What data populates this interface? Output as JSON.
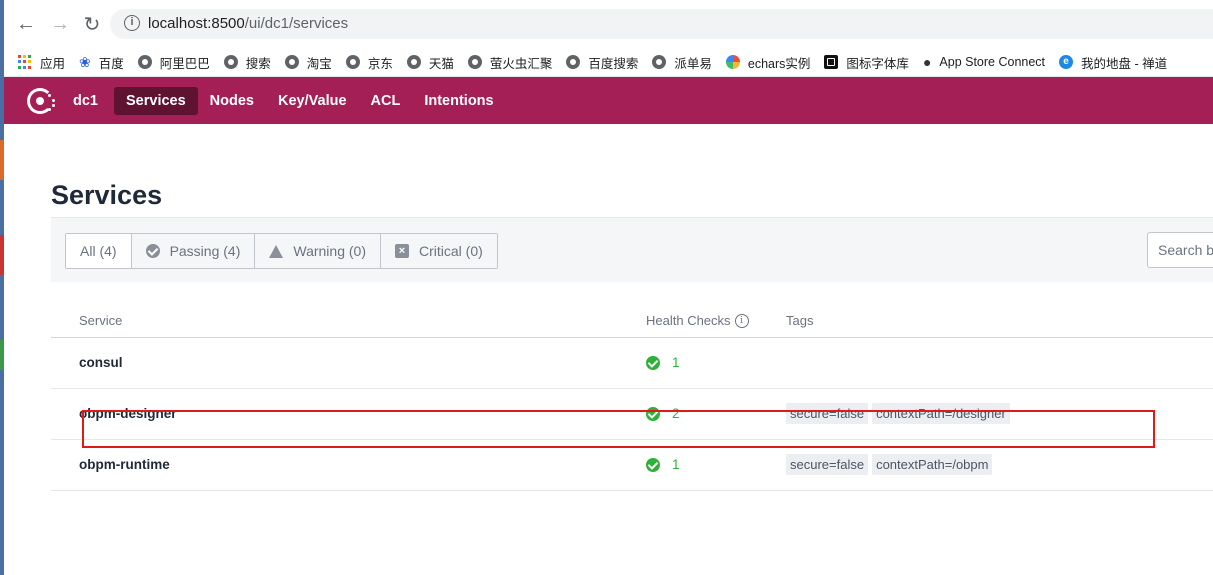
{
  "browser": {
    "url_host": "localhost:8500",
    "url_path": "/ui/dc1/services"
  },
  "bookmarks": [
    {
      "label": "应用",
      "icon": "apps-grid-icon"
    },
    {
      "label": "百度",
      "icon": "baidu-paw-icon"
    },
    {
      "label": "阿里巴巴",
      "icon": "globe-icon"
    },
    {
      "label": "搜索",
      "icon": "globe-icon"
    },
    {
      "label": "淘宝",
      "icon": "globe-icon"
    },
    {
      "label": "京东",
      "icon": "globe-icon"
    },
    {
      "label": "天猫",
      "icon": "globe-icon"
    },
    {
      "label": "萤火虫汇聚",
      "icon": "globe-icon"
    },
    {
      "label": "百度搜索",
      "icon": "globe-icon"
    },
    {
      "label": "派单易",
      "icon": "globe-icon"
    },
    {
      "label": "echars实例",
      "icon": "echarts-icon"
    },
    {
      "label": "图标字体库",
      "icon": "iconfont-icon"
    },
    {
      "label": "App Store Connect",
      "icon": "apple-icon"
    },
    {
      "label": "我的地盘 - 禅道",
      "icon": "zentao-icon"
    }
  ],
  "nav": {
    "datacenter": "dc1",
    "items": [
      "Services",
      "Nodes",
      "Key/Value",
      "ACL",
      "Intentions"
    ],
    "active": "Services",
    "brand_color": "#a31f56"
  },
  "page": {
    "title": "Services"
  },
  "filters": [
    {
      "label": "All (4)",
      "icon": null
    },
    {
      "label": "Passing (4)",
      "icon": "check-circle-icon"
    },
    {
      "label": "Warning (0)",
      "icon": "warning-triangle-icon"
    },
    {
      "label": "Critical (0)",
      "icon": "critical-x-icon"
    }
  ],
  "search": {
    "placeholder": "Search by name"
  },
  "table": {
    "headers": {
      "service": "Service",
      "health": "Health Checks",
      "tags": "Tags"
    },
    "rows": [
      {
        "name": "consul",
        "checks": "1",
        "tags": []
      },
      {
        "name": "obpm-designer",
        "checks": "2",
        "tags": [
          "secure=false",
          "contextPath=/designer"
        ]
      },
      {
        "name": "obpm-runtime",
        "checks": "1",
        "tags": [
          "secure=false",
          "contextPath=/obpm"
        ]
      }
    ]
  },
  "colors": {
    "passing": "#2eb039",
    "annotation": "#e01919"
  }
}
